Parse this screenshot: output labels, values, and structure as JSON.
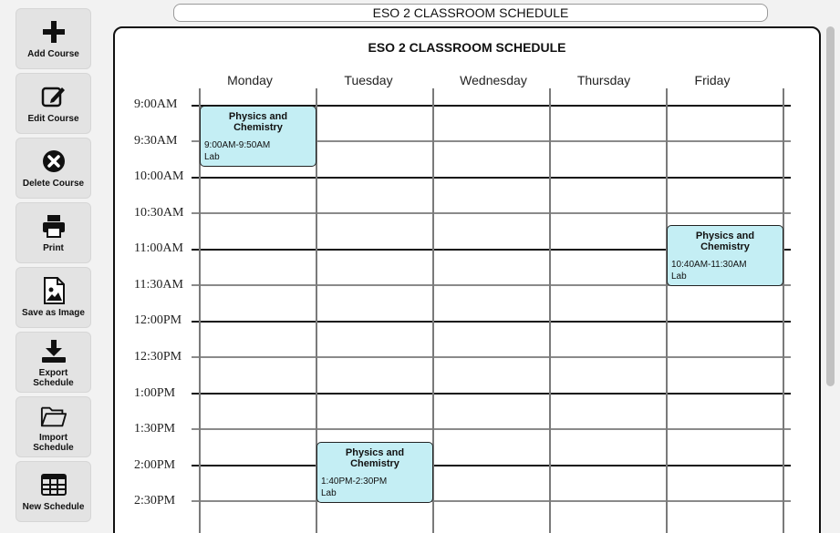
{
  "toolbar": {
    "add_course": "Add Course",
    "edit_course": "Edit Course",
    "delete_course": "Delete Course",
    "print": "Print",
    "save_image": "Save as Image",
    "export_schedule": "Export\nSchedule",
    "import_schedule": "Import\nSchedule",
    "new_schedule": "New Schedule"
  },
  "title_bar": "ESO 2 CLASSROOM SCHEDULE",
  "schedule": {
    "title": "ESO 2 CLASSROOM SCHEDULE",
    "days": [
      "Monday",
      "Tuesday",
      "Wednesday",
      "Thursday",
      "Friday"
    ],
    "times": [
      "9:00AM",
      "9:30AM",
      "10:00AM",
      "10:30AM",
      "11:00AM",
      "11:30AM",
      "12:00PM",
      "12:30PM",
      "1:00PM",
      "1:30PM",
      "2:00PM",
      "2:30PM"
    ],
    "courses": [
      {
        "name": "Physics and Chemistry",
        "time": "9:00AM-9:50AM",
        "room": "Lab",
        "day": "Monday"
      },
      {
        "name": "Physics and Chemistry",
        "time": "10:40AM-11:30AM",
        "room": "Lab",
        "day": "Friday"
      },
      {
        "name": "Physics and Chemistry",
        "time": "1:40PM-2:30PM",
        "room": "Lab",
        "day": "Tuesday"
      }
    ]
  },
  "colors": {
    "course_fill": "#c4eef4",
    "button_bg": "#e3e3e3"
  },
  "icons": [
    "plus-icon",
    "edit-icon",
    "delete-icon",
    "print-icon",
    "image-icon",
    "download-icon",
    "folder-icon",
    "grid-icon"
  ]
}
